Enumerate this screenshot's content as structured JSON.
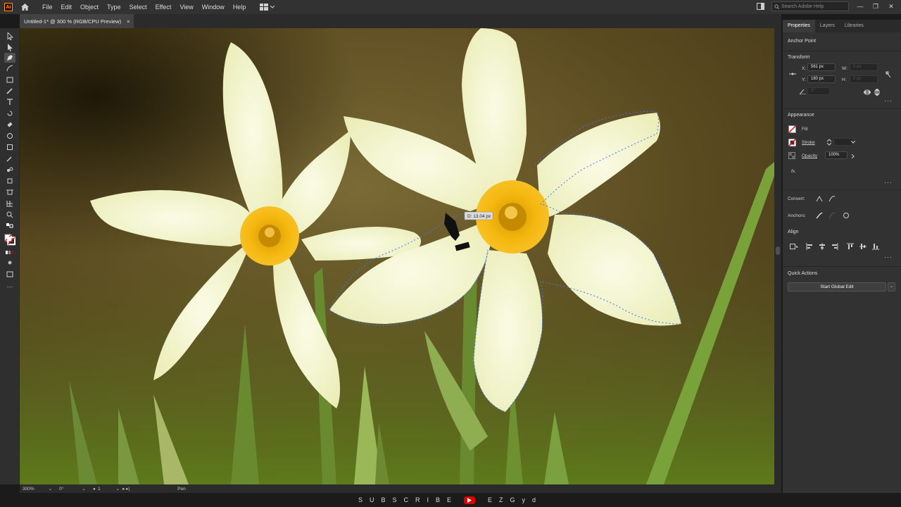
{
  "app": {
    "logo": "Ai"
  },
  "menubar": {
    "items": [
      "File",
      "Edit",
      "Object",
      "Type",
      "Select",
      "Effect",
      "View",
      "Window",
      "Help"
    ],
    "search_placeholder": "Search Adobe Help"
  },
  "document": {
    "tab_title": "Untitled-1* @ 300 % (RGB/CPU Preview)",
    "close": "×"
  },
  "canvas": {
    "measure_tooltip": "D: 13.04 px"
  },
  "status": {
    "zoom": "300%",
    "rotation": "0°",
    "artboard": "1",
    "tool": "Pen"
  },
  "panel": {
    "tabs": [
      "Properties",
      "Layers",
      "Libraries"
    ],
    "active_tab": "Properties",
    "selection_type": "Anchor Point",
    "transform": {
      "title": "Transform",
      "x_label": "X:",
      "x_value": "561 px",
      "y_label": "Y:",
      "y_value": "180 px",
      "w_label": "W:",
      "w_value": "0 px",
      "h_label": "H:",
      "h_value": "0 px",
      "angle_value": "0°"
    },
    "appearance": {
      "title": "Appearance",
      "fill_label": "Fill",
      "stroke_label": "Stroke",
      "opacity_label": "Opacity",
      "opacity_value": "100%",
      "fx_label": "fx."
    },
    "convert_label": "Convert:",
    "anchors_label": "Anchors:",
    "align_title": "Align",
    "quick_actions_title": "Quick Actions",
    "global_edit_button": "Start Global Edit"
  },
  "banner": {
    "text_left": "SUBSCRIBE",
    "text_right": "EZGyd"
  },
  "colors": {
    "accent": "#ff9a00",
    "panel_bg": "#323232",
    "menubar_bg": "#323232",
    "youtube_red": "#e00000",
    "path_blue": "#3b78ff"
  }
}
